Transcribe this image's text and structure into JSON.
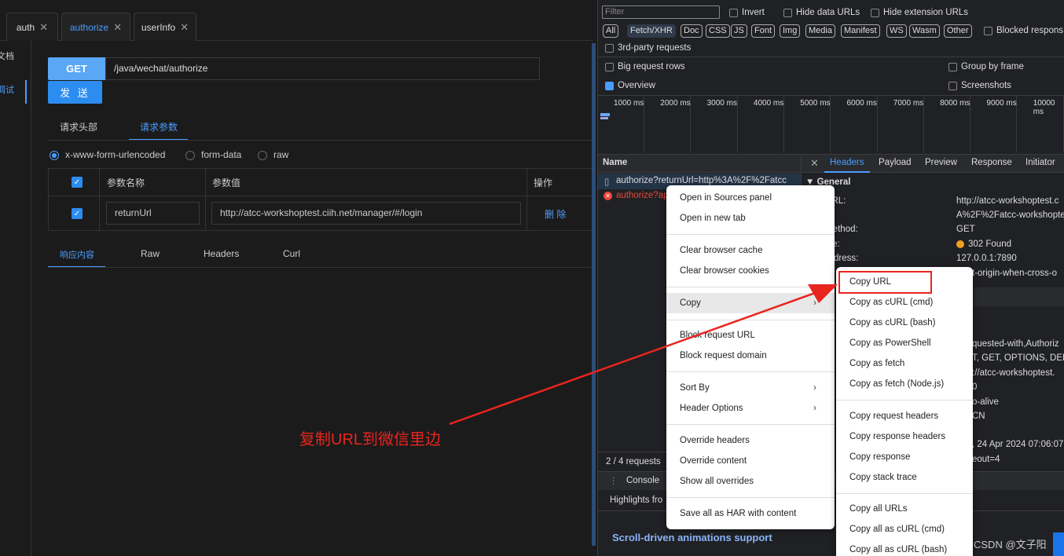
{
  "tabs": [
    {
      "label": "auth"
    },
    {
      "label": "authorize"
    },
    {
      "label": "userInfo"
    }
  ],
  "sidenav": {
    "doc": "文档",
    "debug": "调试"
  },
  "request": {
    "method": "GET",
    "url": "/java/wechat/authorize",
    "send": "发 送"
  },
  "subtabs": {
    "headers": "请求头部",
    "params": "请求参数"
  },
  "body_types": [
    "x-www-form-urlencoded",
    "form-data",
    "raw"
  ],
  "param_table": {
    "col_name": "参数名称",
    "col_value": "参数值",
    "col_action": "操作",
    "row": {
      "name": "returnUrl",
      "value": "http://atcc-workshoptest.ciih.net/manager/#/login",
      "action": "删 除"
    }
  },
  "response_tabs": [
    "响应内容",
    "Raw",
    "Headers",
    "Curl"
  ],
  "devtools": {
    "filter_placeholder": "Filter",
    "filter_opts": [
      "Invert",
      "Hide data URLs",
      "Hide extension URLs"
    ],
    "types": [
      "All",
      "Fetch/XHR",
      "Doc",
      "CSS",
      "JS",
      "Font",
      "Img",
      "Media",
      "Manifest",
      "WS",
      "Wasm",
      "Other"
    ],
    "blocked": "Blocked respons",
    "third_party": "3rd-party requests",
    "big_rows": "Big request rows",
    "group_frame": "Group by frame",
    "overview": "Overview",
    "screenshots": "Screenshots",
    "ticks": [
      "1000 ms",
      "2000 ms",
      "3000 ms",
      "4000 ms",
      "5000 ms",
      "6000 ms",
      "7000 ms",
      "8000 ms",
      "9000 ms",
      "10000 ms"
    ],
    "name_header": "Name",
    "req1": "authorize?returnUrl=http%3A%2F%2Fatcc",
    "req2": "authorize?ap",
    "detail_tabs": [
      "Headers",
      "Payload",
      "Preview",
      "Response",
      "Initiator"
    ],
    "general": "▼ General",
    "kv_keys": [
      "st URL:",
      "st Method:",
      "Code:",
      "e Address:"
    ],
    "kv_vals": [
      "http://atcc-workshoptest.c",
      "A%2F%2Fatcc-workshopte",
      "GET",
      "302 Found",
      "127.0.0.1:7890",
      "t-origin-when-cross-o"
    ],
    "frag": [
      "quested-with,Authoriz",
      "T, GET, OPTIONS, DELE",
      "://atcc-workshoptest.",
      "0",
      "o-alive",
      "CN",
      ", 24 Apr 2024 07:06:07",
      "eout=4"
    ],
    "summary": "2 / 4 requests",
    "console": "Console",
    "highlights": "Highlights fro",
    "scroll_title": "Scroll-driven animations support",
    "watermark": "CSDN @文子阳"
  },
  "menu": {
    "items": [
      "Open in Sources panel",
      "Open in new tab",
      "Clear browser cache",
      "Clear browser cookies",
      "Copy",
      "Block request URL",
      "Block request domain",
      "Sort By",
      "Header Options",
      "Override headers",
      "Override content",
      "Show all overrides",
      "Save all as HAR with content"
    ]
  },
  "submenu": {
    "items": [
      "Copy URL",
      "Copy as cURL (cmd)",
      "Copy as cURL (bash)",
      "Copy as PowerShell",
      "Copy as fetch",
      "Copy as fetch (Node.js)",
      "Copy request headers",
      "Copy response headers",
      "Copy response",
      "Copy stack trace",
      "Copy all URLs",
      "Copy all as cURL (cmd)",
      "Copy all as cURL (bash)"
    ]
  },
  "annotation": {
    "text": "复制URL到微信里边",
    "color": "#e8251f"
  }
}
